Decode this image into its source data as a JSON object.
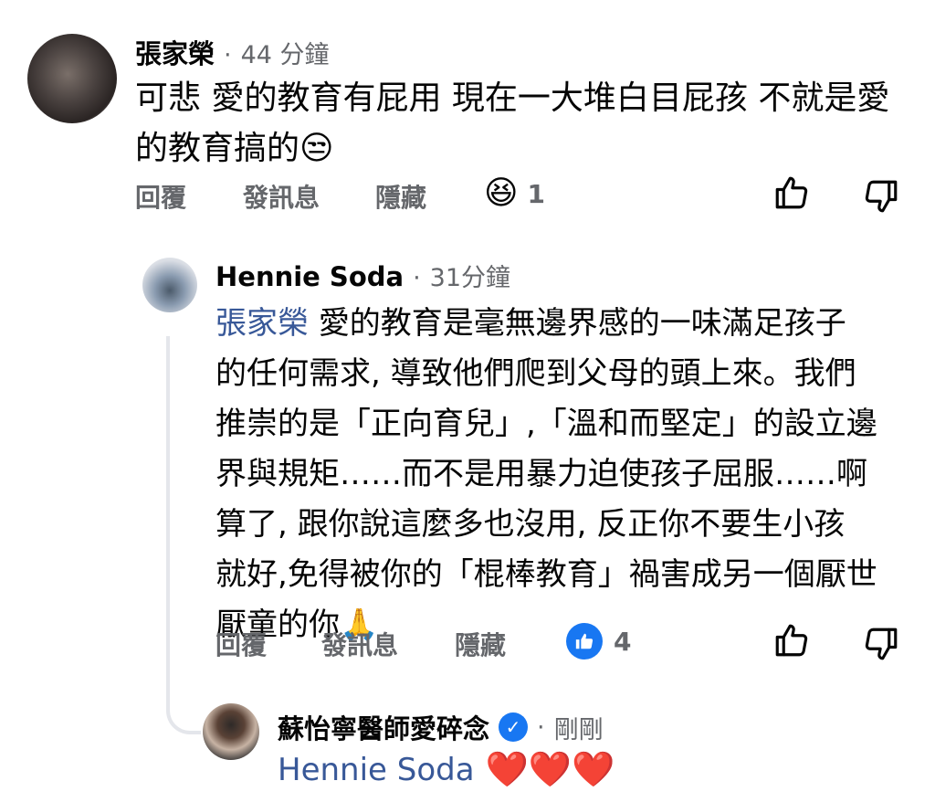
{
  "comment1": {
    "author": "張家榮",
    "separator": "·",
    "time": "44 分鐘",
    "text_line1": "可悲 愛的教育有屁用 現在一大堆白目屁孩 不就是愛",
    "text_line2": "的教育搞的",
    "text_emoji": "😒",
    "actions": {
      "reply": "回覆",
      "message": "發訊息",
      "hide": "隱藏"
    },
    "reaction": {
      "emoji": "😆",
      "count": "1"
    }
  },
  "comment2": {
    "author": "Hennie Soda",
    "separator": "·",
    "time": "31分鐘",
    "mention": "張家榮",
    "text_line1": "愛的教育是毫無邊界感的一味滿足孩子",
    "text_line2": "的任何需求, 導致他們爬到父母的頭上來。我們",
    "text_line3": "推崇的是「正向育兒」,「溫和而堅定」的設立邊",
    "text_line4": "界與規矩……而不是用暴力迫使孩子屈服……啊",
    "text_line5": "算了, 跟你說這麼多也沒用, 反正你不要生小孩",
    "text_line6": "就好,免得被你的「棍棒教育」禍害成另一個厭世",
    "text_line7": "厭童的你",
    "text_emoji": "🙏",
    "actions": {
      "reply": "回覆",
      "message": "發訊息",
      "hide": "隱藏"
    },
    "reaction": {
      "icon": "like-icon",
      "count": "4"
    }
  },
  "comment3": {
    "author": "蘇怡寧醫師愛碎念",
    "separator": "·",
    "time": "剛剛",
    "mention": "Hennie Soda",
    "hearts": "❤️❤️❤️"
  },
  "colors": {
    "mention": "#385898",
    "like_blue": "#1877f2",
    "muted": "#65676b"
  }
}
